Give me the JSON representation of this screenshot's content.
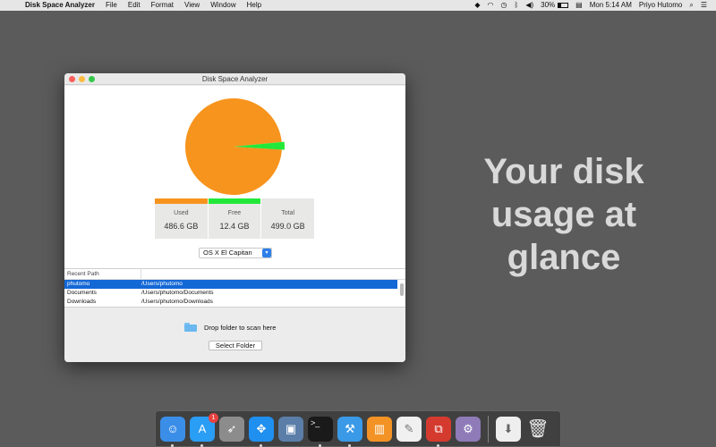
{
  "menubar": {
    "app_name": "Disk Space Analyzer",
    "menus": [
      "File",
      "Edit",
      "Format",
      "View",
      "Window",
      "Help"
    ],
    "battery": "30%",
    "clock": "Mon 5:14 AM",
    "user": "Priyo Hutomo"
  },
  "tagline": "Your disk usage at glance",
  "window": {
    "title": "Disk Space Analyzer",
    "usage": {
      "used_fraction": 0.975,
      "free_fraction": 0.025
    },
    "colors": {
      "used": "#f7941d",
      "free": "#22e83a"
    },
    "stats": [
      {
        "label": "Used",
        "value": "486.6 GB"
      },
      {
        "label": "Free",
        "value": "12.4 GB"
      },
      {
        "label": "Total",
        "value": "499.0 GB"
      }
    ],
    "volume": {
      "selected": "OS X El Capitan"
    },
    "table": {
      "header": "Recent Path",
      "rows": [
        {
          "name": "phutomo",
          "path": "/Users/phutomo"
        },
        {
          "name": "Documents",
          "path": "/Users/phutomo/Documents"
        },
        {
          "name": "Downloads",
          "path": "/Users/phutomo/Downloads"
        }
      ]
    },
    "drop_text": "Drop folder to scan here",
    "select_folder_label": "Select Folder"
  },
  "dock": {
    "badge_count": "1",
    "items": [
      {
        "name": "finder-icon",
        "color": "#3b8ee8"
      },
      {
        "name": "app-store-icon",
        "color": "#2a9df4"
      },
      {
        "name": "launchpad-icon",
        "color": "#8c8c8c"
      },
      {
        "name": "safari-icon",
        "color": "#1f8ff0"
      },
      {
        "name": "preview-icon",
        "color": "#5a7ea8"
      },
      {
        "name": "terminal-icon",
        "color": "#1a1a1a"
      },
      {
        "name": "xcode-icon",
        "color": "#3a9ae8"
      },
      {
        "name": "ibooks-icon",
        "color": "#f39325"
      },
      {
        "name": "textedit-icon",
        "color": "#f0f0f0"
      },
      {
        "name": "parallels-icon",
        "color": "#d53a2e"
      },
      {
        "name": "system-preferences-icon",
        "color": "#8e7bb8"
      }
    ]
  }
}
